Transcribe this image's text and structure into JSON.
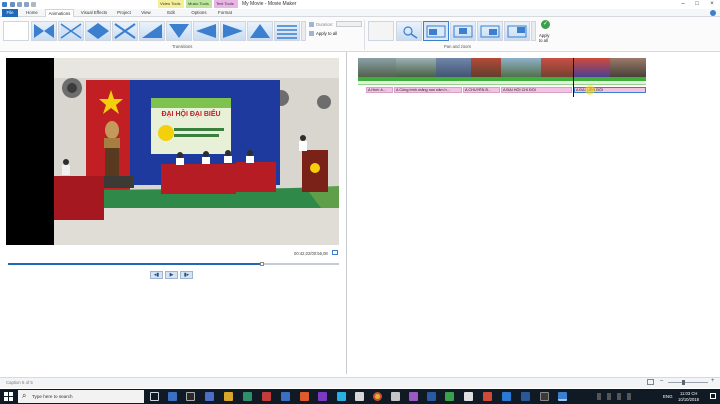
{
  "window": {
    "title": "My Movie - Movie Maker"
  },
  "context_tabs": [
    "Video Tools",
    "Music Tools",
    "Text Tools"
  ],
  "tabs": [
    "File",
    "Home",
    "Animations",
    "Visual Effects",
    "Project",
    "View",
    "Edit",
    "Options",
    "Format"
  ],
  "active_tab": "Animations",
  "ribbon": {
    "transitions_label": "Transitions",
    "duration_label": "Duration:",
    "apply_all_label": "Apply to all",
    "pan_zoom_label": "Pan and zoom",
    "apply_all_big_line1": "Apply",
    "apply_all_big_line2": "to all"
  },
  "preview": {
    "time": "00:42,02/00:56,08"
  },
  "storyboard": {
    "captions": [
      "A Hình ả...",
      "A Công trình măng non năm h...",
      "A CHUYÊN Đ...",
      "A ĐẠI HỘI CHI ĐỘI",
      "A ĐẠI LIÊN ĐỘI"
    ]
  },
  "status": {
    "text": "Caption 5 of 5"
  },
  "taskbar": {
    "search_placeholder": "Type here to search",
    "lang": "ENG",
    "time": "11:03 CH",
    "date": "10/10/2018"
  },
  "colors": {
    "file_tab": "#1e69b8",
    "caption_bg": "#f4c2e3",
    "taskbar": "#101a24",
    "seek_fill": "#1e69b8"
  }
}
